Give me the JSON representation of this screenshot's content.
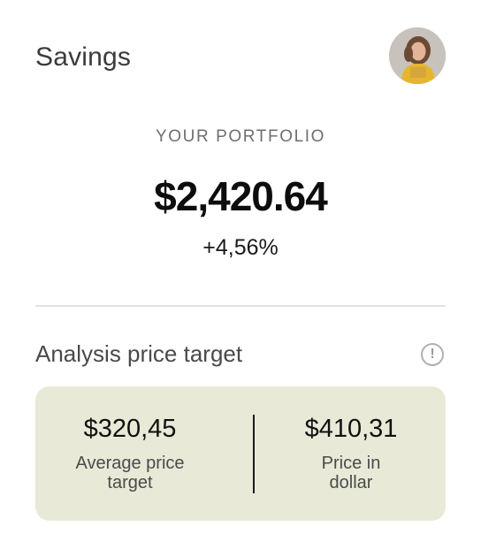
{
  "header": {
    "title": "Savings",
    "avatar_icon": "user-avatar-photo"
  },
  "portfolio": {
    "label": "YOUR PORTFOLIO",
    "value": "$2,420.64",
    "change": "+4,56%"
  },
  "analysis": {
    "title": "Analysis price target",
    "info_icon": "info-icon",
    "info_symbol": "!",
    "average": {
      "amount": "$320,45",
      "label": "Average price target"
    },
    "price": {
      "amount": "$410,31",
      "label": "Price in dollar"
    }
  },
  "colors": {
    "card_background": "#e8ead7",
    "divider": "#e2e2e2",
    "accent_yellow": "#e5b62c"
  }
}
